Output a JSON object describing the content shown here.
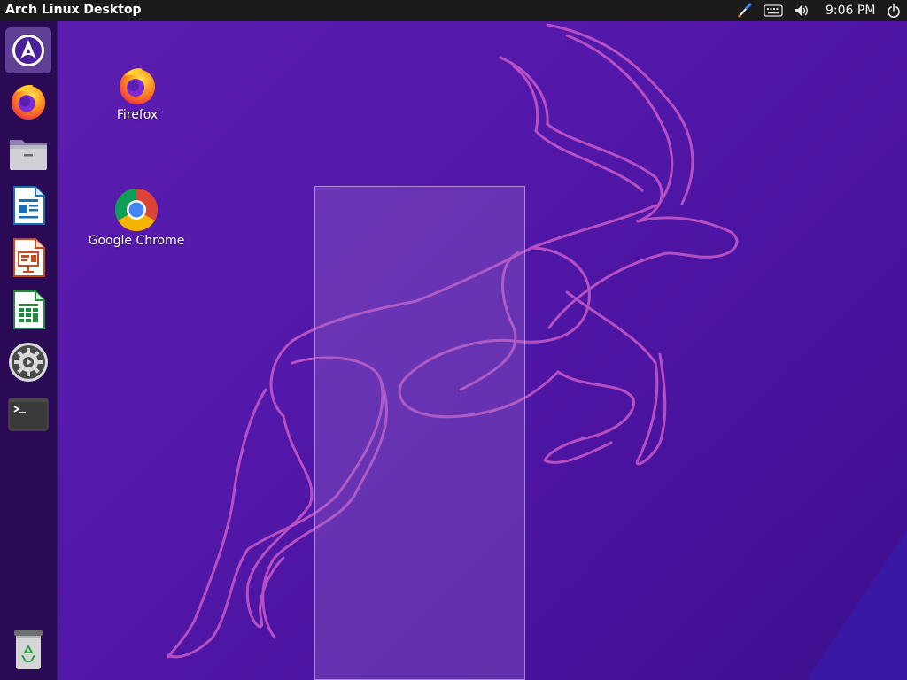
{
  "topbar": {
    "title": "Arch Linux Desktop",
    "clock": "9:06 PM",
    "tray_icons": [
      "paintbrush-icon",
      "keyboard-icon",
      "volume-icon",
      "power-icon"
    ]
  },
  "dock": {
    "items": [
      {
        "name": "arch-linux-menu",
        "icon": "arch-logo-icon",
        "active": true
      },
      {
        "name": "firefox",
        "icon": "firefox-icon"
      },
      {
        "name": "files",
        "icon": "folder-icon"
      },
      {
        "name": "libreoffice-writer",
        "icon": "writer-icon"
      },
      {
        "name": "libreoffice-impress",
        "icon": "impress-icon"
      },
      {
        "name": "libreoffice-calc",
        "icon": "calc-icon"
      },
      {
        "name": "settings",
        "icon": "gear-icon"
      },
      {
        "name": "terminal",
        "icon": "terminal-icon"
      },
      {
        "name": "trash",
        "icon": "trash-icon"
      }
    ]
  },
  "desktop": {
    "icons": [
      {
        "label": "Firefox",
        "icon": "firefox-icon"
      },
      {
        "label": "Google Chrome",
        "icon": "chrome-icon"
      }
    ]
  },
  "colors": {
    "background": "#5318aa",
    "topbar": "#1b1b1b",
    "dock": "#2a0a55",
    "gazelle_line": "#c85ac8"
  }
}
